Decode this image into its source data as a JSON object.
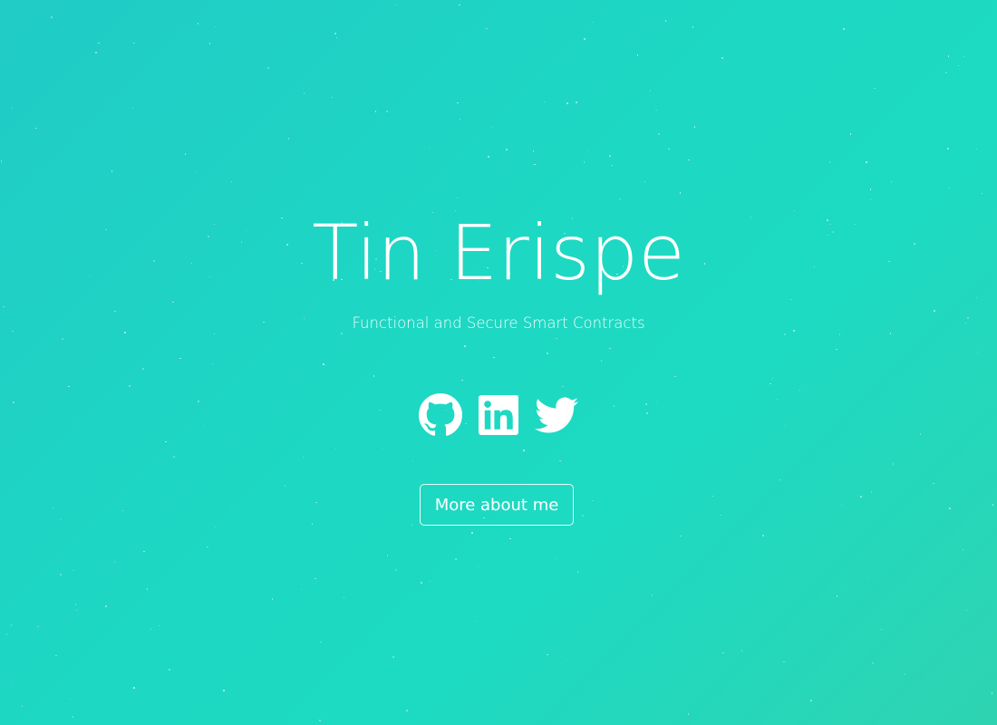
{
  "hero": {
    "title": "Tin Erispe",
    "subtitle": "Functional and Secure Smart Contracts",
    "cta_label": "More about me"
  },
  "socials": [
    {
      "name": "github",
      "icon": "github-icon"
    },
    {
      "name": "linkedin",
      "icon": "linkedin-icon"
    },
    {
      "name": "twitter",
      "icon": "twitter-icon"
    }
  ],
  "colors": {
    "background_start": "#21cbc6",
    "background_mid": "#1dd8c3",
    "background_end": "#2ed4b2",
    "foreground": "#ffffff"
  }
}
